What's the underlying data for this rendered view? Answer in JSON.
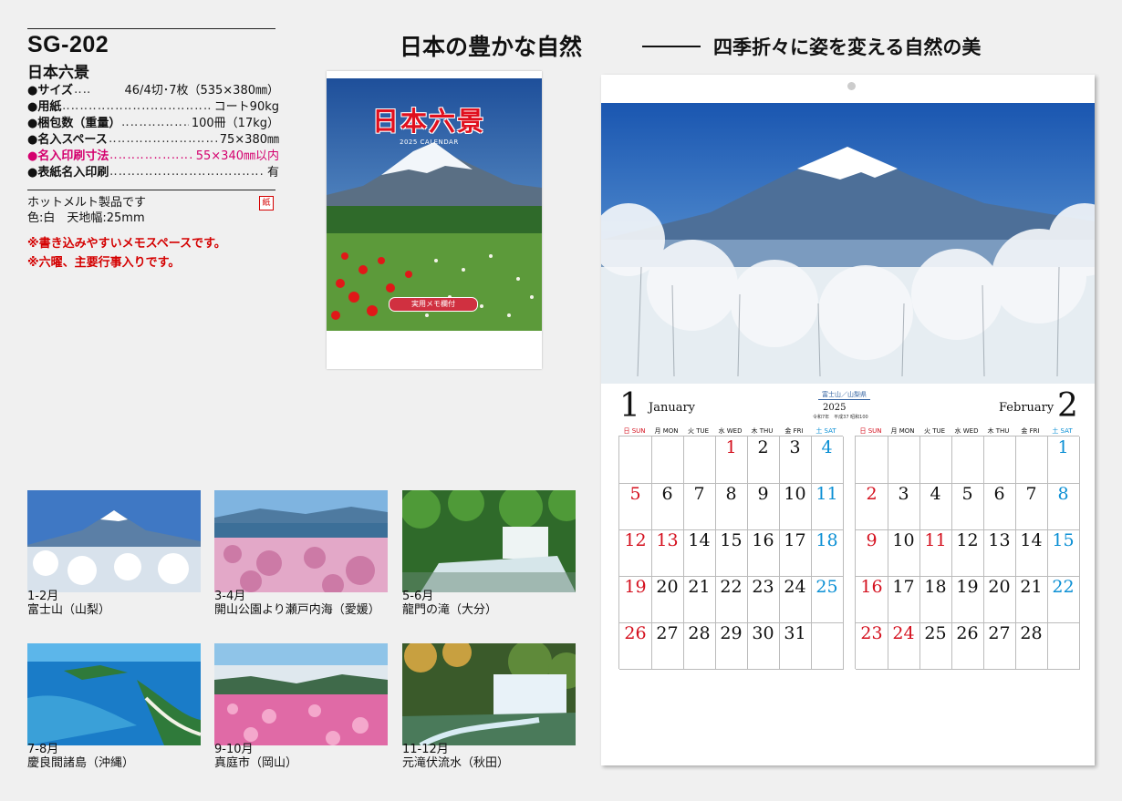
{
  "product": {
    "model": "SG-202",
    "name": "日本六景",
    "specs": [
      {
        "label": "●サイズ",
        "dots": "‥‥",
        "value": "46/4切･7枚（535×380㎜）",
        "highlight": false
      },
      {
        "label": "●用紙",
        "dots": "‥‥‥‥‥‥‥‥‥‥‥‥‥‥‥‥‥‥‥‥‥‥‥",
        "value": "コート90kg",
        "highlight": false
      },
      {
        "label": "●梱包数（重量）",
        "dots": "‥‥‥‥‥‥‥‥‥‥‥‥‥‥‥",
        "value": "100冊（17kg）",
        "highlight": false
      },
      {
        "label": "●名入スペース",
        "dots": "‥‥‥‥‥‥‥‥‥‥‥‥‥‥‥‥",
        "value": "75×380㎜",
        "highlight": false
      },
      {
        "label": "●名入印刷寸法",
        "dots": "‥‥‥‥‥‥‥‥‥‥‥",
        "value": "55×340㎜以内",
        "highlight": true
      },
      {
        "label": "●表紙名入印刷",
        "dots": "‥‥‥‥‥‥‥‥‥‥‥‥‥‥‥‥‥‥‥‥",
        "value": "有",
        "highlight": false
      }
    ],
    "notes": [
      "ホットメルト製品です",
      "色:白　天地幅:25mm"
    ],
    "paper_mark": "紙",
    "red_notes": [
      "※書き込みやすいメモスペースです。",
      "※六曜、主要行事入りです。"
    ]
  },
  "headline": {
    "title": "日本の豊かな自然",
    "subtitle": "四季折々に姿を変える自然の美"
  },
  "cover": {
    "title": "日本六景",
    "sub": "2025 CALENDAR",
    "badge": "実用メモ欄付"
  },
  "thumbnails": [
    {
      "months": "1-2月",
      "place": "富士山（山梨）"
    },
    {
      "months": "3-4月",
      "place": "開山公園より瀬戸内海（愛媛）"
    },
    {
      "months": "5-6月",
      "place": "龍門の滝（大分）"
    },
    {
      "months": "7-8月",
      "place": "慶良間諸島（沖縄）"
    },
    {
      "months": "9-10月",
      "place": "真庭市（岡山）"
    },
    {
      "months": "11-12月",
      "place": "元滝伏流水（秋田）"
    }
  ],
  "calendar": {
    "place": "富士山／山梨県",
    "year": "2025",
    "era": "令和7年　平成37 昭和100",
    "weekdays": [
      "日 SUN",
      "月 MON",
      "火 TUE",
      "水 WED",
      "木 THU",
      "金 FRI",
      "土 SAT"
    ],
    "months": [
      {
        "num": "1",
        "name": "January",
        "days": [
          [
            "",
            "",
            "",
            "1",
            "2",
            "3",
            "4"
          ],
          [
            "5",
            "6",
            "7",
            "8",
            "9",
            "10",
            "11"
          ],
          [
            "12",
            "13",
            "14",
            "15",
            "16",
            "17",
            "18"
          ],
          [
            "19",
            "20",
            "21",
            "22",
            "23",
            "24",
            "25"
          ],
          [
            "26",
            "27",
            "28",
            "29",
            "30",
            "31",
            ""
          ]
        ],
        "holidays": [
          "1",
          "13"
        ]
      },
      {
        "num": "2",
        "name": "February",
        "days": [
          [
            "",
            "",
            "",
            "",
            "",
            "",
            "1"
          ],
          [
            "2",
            "3",
            "4",
            "5",
            "6",
            "7",
            "8"
          ],
          [
            "9",
            "10",
            "11",
            "12",
            "13",
            "14",
            "15"
          ],
          [
            "16",
            "17",
            "18",
            "19",
            "20",
            "21",
            "22"
          ],
          [
            "23",
            "24",
            "25",
            "26",
            "27",
            "28",
            ""
          ]
        ],
        "holidays": [
          "11",
          "23",
          "24"
        ]
      }
    ]
  },
  "colors": {
    "holiday": "#d4101e",
    "saturday": "#0a8fd4",
    "pink": "#d4006e"
  }
}
